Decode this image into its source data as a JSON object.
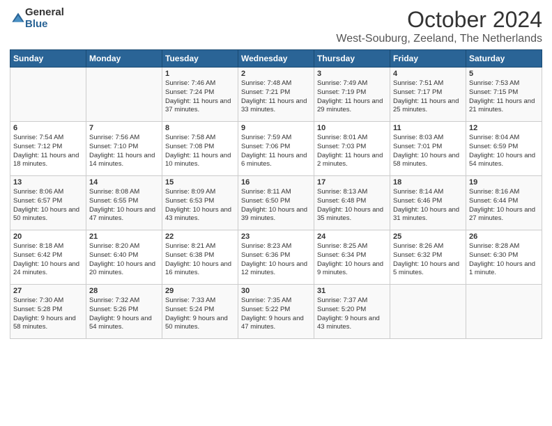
{
  "logo": {
    "general": "General",
    "blue": "Blue"
  },
  "title": "October 2024",
  "location": "West-Souburg, Zeeland, The Netherlands",
  "days_of_week": [
    "Sunday",
    "Monday",
    "Tuesday",
    "Wednesday",
    "Thursday",
    "Friday",
    "Saturday"
  ],
  "weeks": [
    [
      {
        "day": "",
        "sunrise": "",
        "sunset": "",
        "daylight": ""
      },
      {
        "day": "",
        "sunrise": "",
        "sunset": "",
        "daylight": ""
      },
      {
        "day": "1",
        "sunrise": "Sunrise: 7:46 AM",
        "sunset": "Sunset: 7:24 PM",
        "daylight": "Daylight: 11 hours and 37 minutes."
      },
      {
        "day": "2",
        "sunrise": "Sunrise: 7:48 AM",
        "sunset": "Sunset: 7:21 PM",
        "daylight": "Daylight: 11 hours and 33 minutes."
      },
      {
        "day": "3",
        "sunrise": "Sunrise: 7:49 AM",
        "sunset": "Sunset: 7:19 PM",
        "daylight": "Daylight: 11 hours and 29 minutes."
      },
      {
        "day": "4",
        "sunrise": "Sunrise: 7:51 AM",
        "sunset": "Sunset: 7:17 PM",
        "daylight": "Daylight: 11 hours and 25 minutes."
      },
      {
        "day": "5",
        "sunrise": "Sunrise: 7:53 AM",
        "sunset": "Sunset: 7:15 PM",
        "daylight": "Daylight: 11 hours and 21 minutes."
      }
    ],
    [
      {
        "day": "6",
        "sunrise": "Sunrise: 7:54 AM",
        "sunset": "Sunset: 7:12 PM",
        "daylight": "Daylight: 11 hours and 18 minutes."
      },
      {
        "day": "7",
        "sunrise": "Sunrise: 7:56 AM",
        "sunset": "Sunset: 7:10 PM",
        "daylight": "Daylight: 11 hours and 14 minutes."
      },
      {
        "day": "8",
        "sunrise": "Sunrise: 7:58 AM",
        "sunset": "Sunset: 7:08 PM",
        "daylight": "Daylight: 11 hours and 10 minutes."
      },
      {
        "day": "9",
        "sunrise": "Sunrise: 7:59 AM",
        "sunset": "Sunset: 7:06 PM",
        "daylight": "Daylight: 11 hours and 6 minutes."
      },
      {
        "day": "10",
        "sunrise": "Sunrise: 8:01 AM",
        "sunset": "Sunset: 7:03 PM",
        "daylight": "Daylight: 11 hours and 2 minutes."
      },
      {
        "day": "11",
        "sunrise": "Sunrise: 8:03 AM",
        "sunset": "Sunset: 7:01 PM",
        "daylight": "Daylight: 10 hours and 58 minutes."
      },
      {
        "day": "12",
        "sunrise": "Sunrise: 8:04 AM",
        "sunset": "Sunset: 6:59 PM",
        "daylight": "Daylight: 10 hours and 54 minutes."
      }
    ],
    [
      {
        "day": "13",
        "sunrise": "Sunrise: 8:06 AM",
        "sunset": "Sunset: 6:57 PM",
        "daylight": "Daylight: 10 hours and 50 minutes."
      },
      {
        "day": "14",
        "sunrise": "Sunrise: 8:08 AM",
        "sunset": "Sunset: 6:55 PM",
        "daylight": "Daylight: 10 hours and 47 minutes."
      },
      {
        "day": "15",
        "sunrise": "Sunrise: 8:09 AM",
        "sunset": "Sunset: 6:53 PM",
        "daylight": "Daylight: 10 hours and 43 minutes."
      },
      {
        "day": "16",
        "sunrise": "Sunrise: 8:11 AM",
        "sunset": "Sunset: 6:50 PM",
        "daylight": "Daylight: 10 hours and 39 minutes."
      },
      {
        "day": "17",
        "sunrise": "Sunrise: 8:13 AM",
        "sunset": "Sunset: 6:48 PM",
        "daylight": "Daylight: 10 hours and 35 minutes."
      },
      {
        "day": "18",
        "sunrise": "Sunrise: 8:14 AM",
        "sunset": "Sunset: 6:46 PM",
        "daylight": "Daylight: 10 hours and 31 minutes."
      },
      {
        "day": "19",
        "sunrise": "Sunrise: 8:16 AM",
        "sunset": "Sunset: 6:44 PM",
        "daylight": "Daylight: 10 hours and 27 minutes."
      }
    ],
    [
      {
        "day": "20",
        "sunrise": "Sunrise: 8:18 AM",
        "sunset": "Sunset: 6:42 PM",
        "daylight": "Daylight: 10 hours and 24 minutes."
      },
      {
        "day": "21",
        "sunrise": "Sunrise: 8:20 AM",
        "sunset": "Sunset: 6:40 PM",
        "daylight": "Daylight: 10 hours and 20 minutes."
      },
      {
        "day": "22",
        "sunrise": "Sunrise: 8:21 AM",
        "sunset": "Sunset: 6:38 PM",
        "daylight": "Daylight: 10 hours and 16 minutes."
      },
      {
        "day": "23",
        "sunrise": "Sunrise: 8:23 AM",
        "sunset": "Sunset: 6:36 PM",
        "daylight": "Daylight: 10 hours and 12 minutes."
      },
      {
        "day": "24",
        "sunrise": "Sunrise: 8:25 AM",
        "sunset": "Sunset: 6:34 PM",
        "daylight": "Daylight: 10 hours and 9 minutes."
      },
      {
        "day": "25",
        "sunrise": "Sunrise: 8:26 AM",
        "sunset": "Sunset: 6:32 PM",
        "daylight": "Daylight: 10 hours and 5 minutes."
      },
      {
        "day": "26",
        "sunrise": "Sunrise: 8:28 AM",
        "sunset": "Sunset: 6:30 PM",
        "daylight": "Daylight: 10 hours and 1 minute."
      }
    ],
    [
      {
        "day": "27",
        "sunrise": "Sunrise: 7:30 AM",
        "sunset": "Sunset: 5:28 PM",
        "daylight": "Daylight: 9 hours and 58 minutes."
      },
      {
        "day": "28",
        "sunrise": "Sunrise: 7:32 AM",
        "sunset": "Sunset: 5:26 PM",
        "daylight": "Daylight: 9 hours and 54 minutes."
      },
      {
        "day": "29",
        "sunrise": "Sunrise: 7:33 AM",
        "sunset": "Sunset: 5:24 PM",
        "daylight": "Daylight: 9 hours and 50 minutes."
      },
      {
        "day": "30",
        "sunrise": "Sunrise: 7:35 AM",
        "sunset": "Sunset: 5:22 PM",
        "daylight": "Daylight: 9 hours and 47 minutes."
      },
      {
        "day": "31",
        "sunrise": "Sunrise: 7:37 AM",
        "sunset": "Sunset: 5:20 PM",
        "daylight": "Daylight: 9 hours and 43 minutes."
      },
      {
        "day": "",
        "sunrise": "",
        "sunset": "",
        "daylight": ""
      },
      {
        "day": "",
        "sunrise": "",
        "sunset": "",
        "daylight": ""
      }
    ]
  ]
}
